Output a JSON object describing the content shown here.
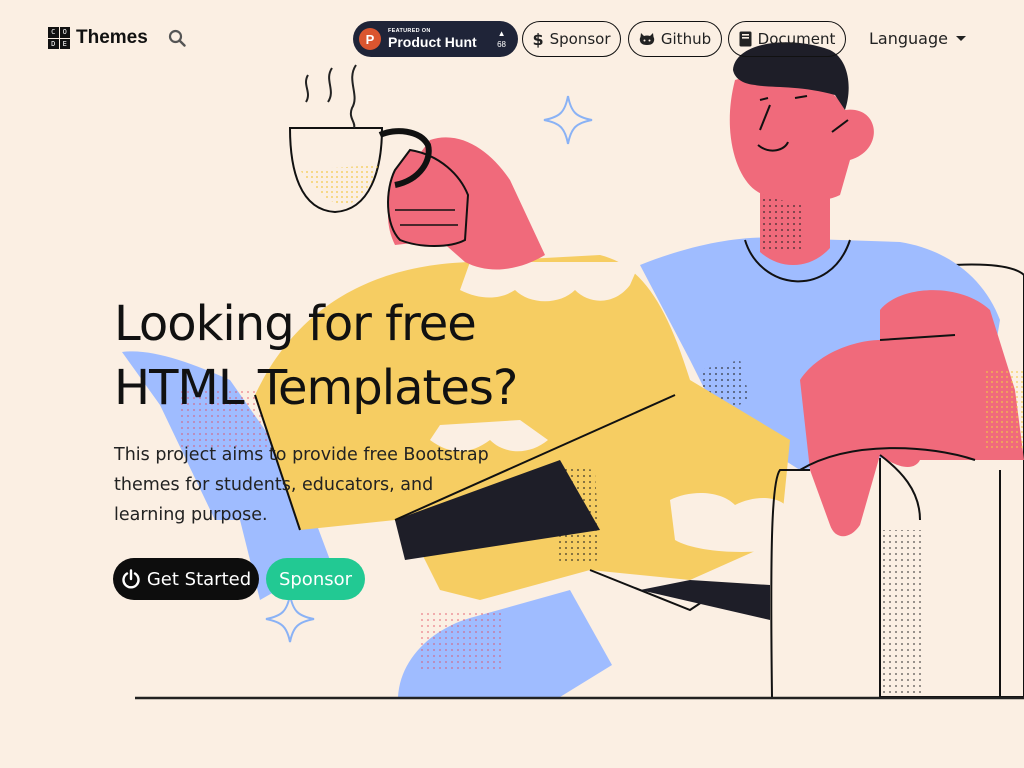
{
  "navbar": {
    "brand_name": "Themes",
    "logo_letters": [
      "C",
      "O",
      "D",
      "E"
    ],
    "product_hunt": {
      "featured_label": "FEATURED ON",
      "name": "Product Hunt",
      "vote_arrow": "▲",
      "votes": "68"
    },
    "sponsor_label": "Sponsor",
    "github_label": "Github",
    "document_label": "Document",
    "language_label": "Language"
  },
  "hero": {
    "title_line1": "Looking for free",
    "title_line2": "HTML Templates?",
    "description": "This project aims to provide free Bootstrap themes for students, educators, and learning purpose.",
    "get_started_label": "Get Started",
    "sponsor_label": "Sponsor"
  },
  "colors": {
    "background": "#fbefe3",
    "skin": "#f06a7b",
    "shirt": "#9fbcff",
    "pants": "#f6cd62",
    "sponsor_button": "#22c993",
    "product_hunt": "#da552f"
  },
  "icons": {
    "search": "search-icon",
    "sponsor": "dollar-icon",
    "github": "github-icon",
    "document": "book-icon",
    "get_started": "power-icon"
  }
}
